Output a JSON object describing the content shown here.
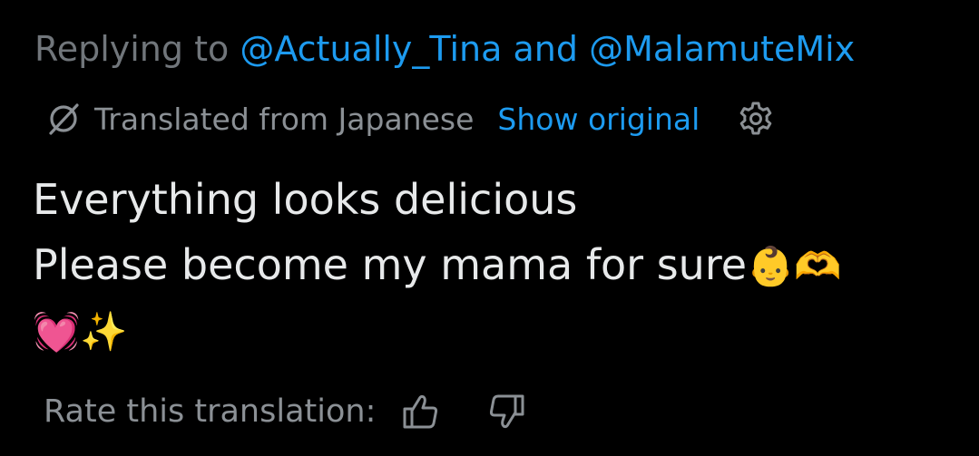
{
  "reply": {
    "prefix": "Replying to",
    "mention_1": "@Actually_Tina",
    "joiner": "and",
    "mention_2": "@MalamuteMix"
  },
  "translation": {
    "icon": "translate-slash-icon",
    "label": "Translated from Japanese",
    "show_original": "Show original",
    "settings_icon": "gear-icon"
  },
  "tweet": {
    "line_1": "Everything looks delicious",
    "line_2_text": "Please become my mama for sure",
    "line_2_emoji": "👶🫶",
    "line_3_emoji": "💓✨"
  },
  "rate": {
    "label": "Rate this translation:",
    "thumbs_up_icon": "thumbs-up-icon",
    "thumbs_down_icon": "thumbs-down-icon"
  },
  "colors": {
    "background": "#000000",
    "primary_text": "#e7e9ea",
    "secondary_text": "#71767b",
    "link": "#1d9bf0"
  }
}
